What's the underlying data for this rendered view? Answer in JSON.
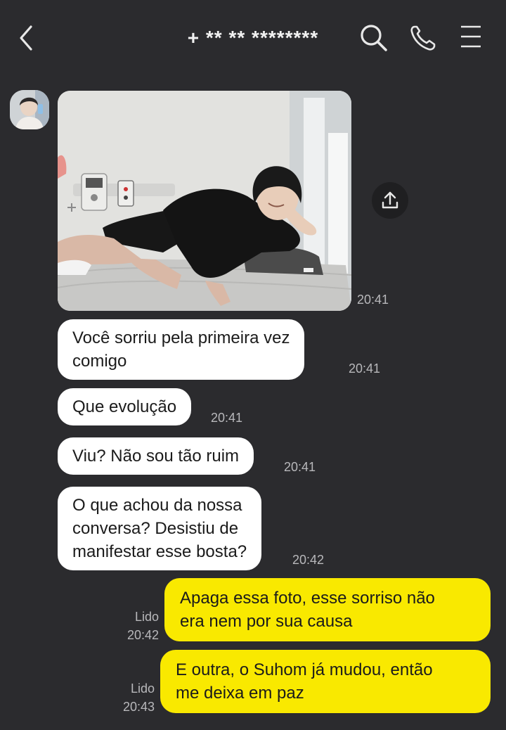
{
  "header": {
    "title": "+ ** ** ********"
  },
  "messages": [
    {
      "type": "image",
      "time": "20:41"
    },
    {
      "text_lines": [
        "Você sorriu pela primeira vez",
        "comigo"
      ],
      "time": "20:41"
    },
    {
      "text_lines": [
        "Que evolução"
      ],
      "time": "20:41"
    },
    {
      "text_lines": [
        "Viu? Não sou tão ruim"
      ],
      "time": "20:41"
    },
    {
      "text_lines": [
        "O que achou da nossa",
        "conversa? Desistiu de",
        "manifestar esse bosta?"
      ],
      "time": "20:42"
    },
    {
      "text_lines": [
        "Apaga essa foto, esse sorriso não",
        "era nem por sua causa"
      ],
      "read": "Lido",
      "time": "20:42"
    },
    {
      "text_lines": [
        "E outra, o Suhom já mudou, então",
        "me deixa em paz"
      ],
      "read": "Lido",
      "time": "20:43"
    }
  ],
  "icons": {
    "back": "chevron-left-icon",
    "search": "search-icon",
    "call": "phone-icon",
    "menu": "menu-icon",
    "share": "share-icon"
  },
  "colors": {
    "background": "#2b2b2e",
    "incoming_bubble": "#ffffff",
    "outgoing_bubble": "#f9e900",
    "timestamp": "#b8b8bb"
  }
}
